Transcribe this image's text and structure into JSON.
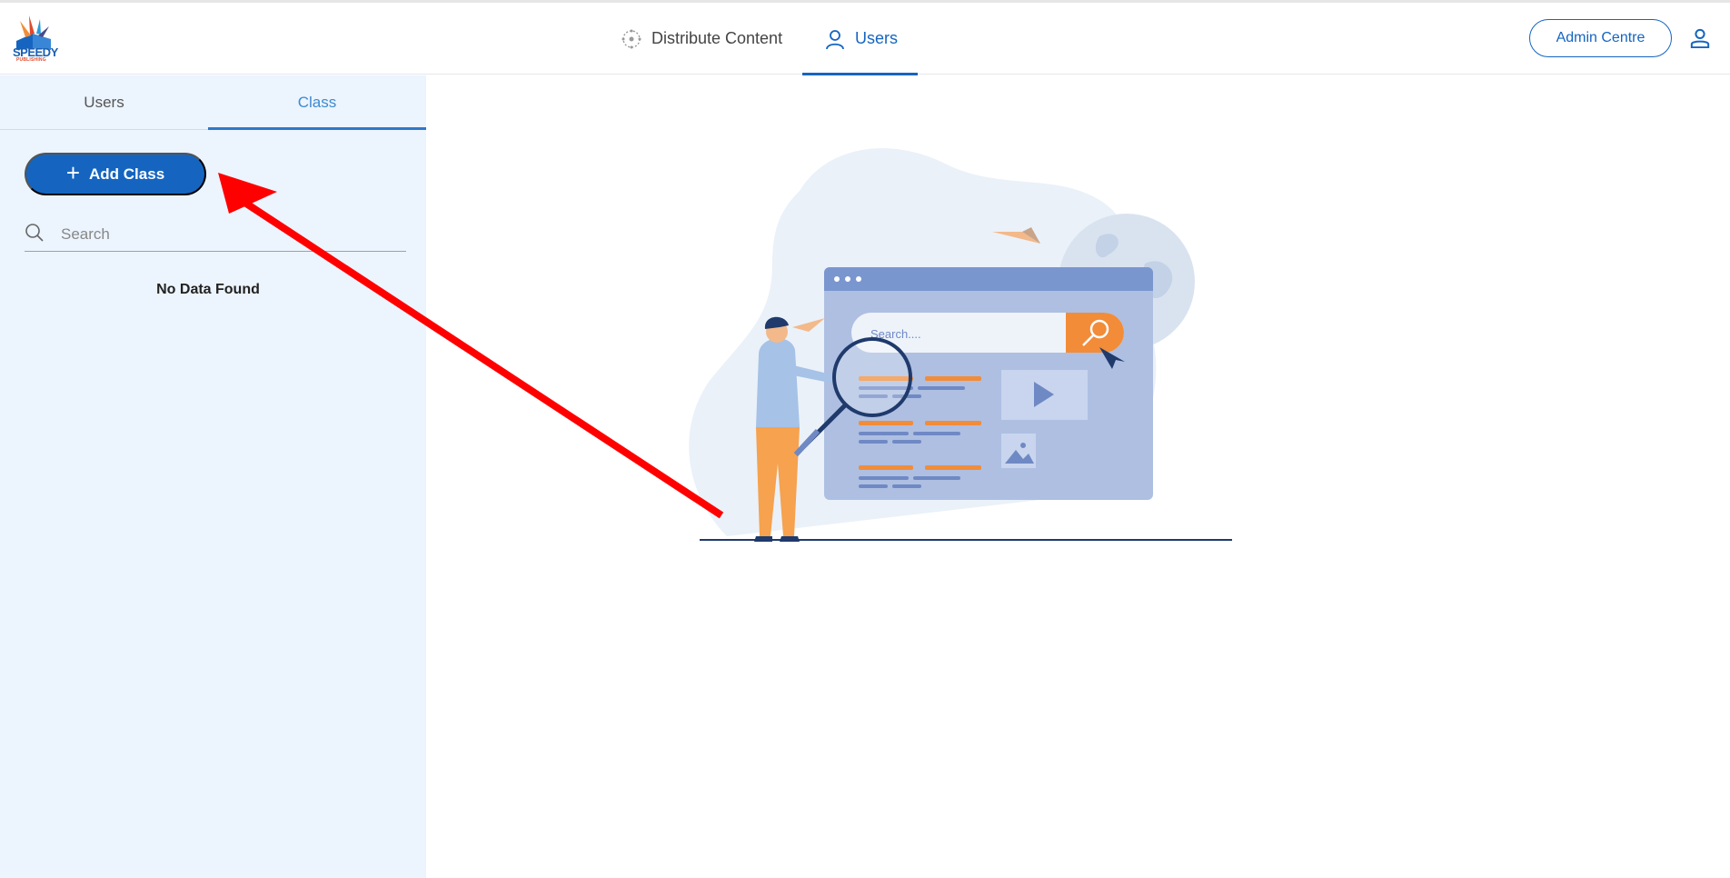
{
  "app": {
    "logo_text": "SPEEDY",
    "logo_subtext": "PUBLISHING"
  },
  "header": {
    "nav": [
      {
        "label": "Distribute Content",
        "icon": "distribute-icon",
        "active": false
      },
      {
        "label": "Users",
        "icon": "user-icon",
        "active": true
      }
    ],
    "admin_button_label": "Admin Centre",
    "profile_icon": "account-icon"
  },
  "sidebar": {
    "tabs": [
      {
        "label": "Users",
        "active": false
      },
      {
        "label": "Class",
        "active": true
      }
    ],
    "add_button_label": "Add Class",
    "search": {
      "placeholder": "Search",
      "value": ""
    },
    "empty_message": "No Data Found"
  },
  "illustration": {
    "search_placeholder": "Search...."
  },
  "colors": {
    "primary": "#1565c0",
    "sidebar_bg": "#ecf4fe",
    "annotation_arrow": "#ff0000",
    "illustration_orange": "#f28c38"
  }
}
